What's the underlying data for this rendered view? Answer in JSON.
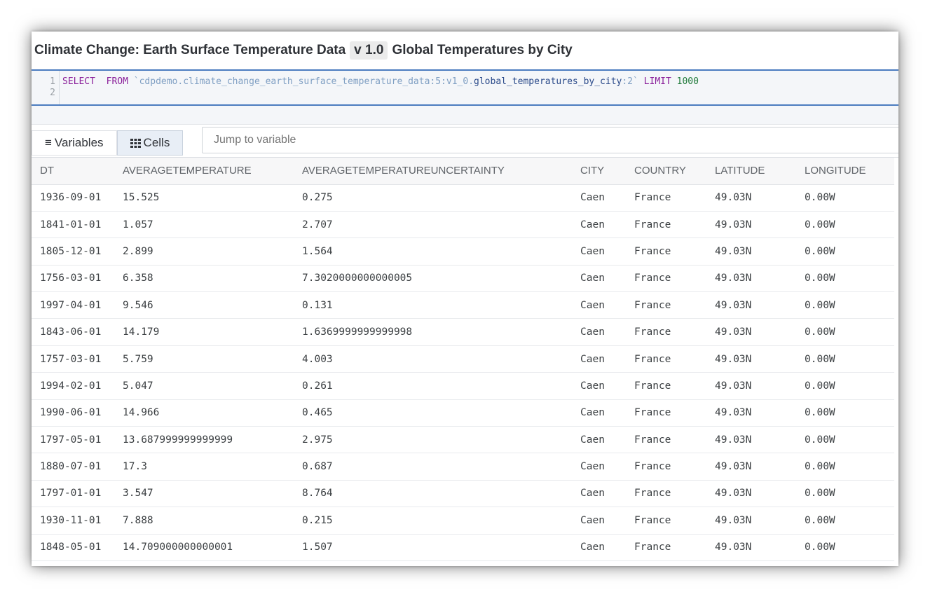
{
  "title": {
    "dataset": "Climate Change: Earth Surface Temperature Data",
    "version": "v 1.0",
    "table": "Global Temperatures by City"
  },
  "editor": {
    "line_numbers": [
      "1",
      "2"
    ],
    "kw_select": "SELECT",
    "kw_from": "FROM",
    "path_part": "`cdpdemo.climate_change_earth_surface_temperature_data:5:v1_0.",
    "ident_part": "global_temperatures_by_city",
    "version_part": ":2`",
    "kw_limit": "LIMIT",
    "limit_value": "1000"
  },
  "tabs": {
    "variables_label": "Variables",
    "cells_label": "Cells"
  },
  "search": {
    "placeholder": "Jump to variable"
  },
  "columns": [
    "DT",
    "AVERAGETEMPERATURE",
    "AVERAGETEMPERATUREUNCERTAINTY",
    "CITY",
    "COUNTRY",
    "LATITUDE",
    "LONGITUDE"
  ],
  "rows": [
    [
      "1936-09-01",
      "15.525",
      "0.275",
      "Caen",
      "France",
      "49.03N",
      "0.00W"
    ],
    [
      "1841-01-01",
      "1.057",
      "2.707",
      "Caen",
      "France",
      "49.03N",
      "0.00W"
    ],
    [
      "1805-12-01",
      "2.899",
      "1.564",
      "Caen",
      "France",
      "49.03N",
      "0.00W"
    ],
    [
      "1756-03-01",
      "6.358",
      "7.3020000000000005",
      "Caen",
      "France",
      "49.03N",
      "0.00W"
    ],
    [
      "1997-04-01",
      "9.546",
      "0.131",
      "Caen",
      "France",
      "49.03N",
      "0.00W"
    ],
    [
      "1843-06-01",
      "14.179",
      "1.6369999999999998",
      "Caen",
      "France",
      "49.03N",
      "0.00W"
    ],
    [
      "1757-03-01",
      "5.759",
      "4.003",
      "Caen",
      "France",
      "49.03N",
      "0.00W"
    ],
    [
      "1994-02-01",
      "5.047",
      "0.261",
      "Caen",
      "France",
      "49.03N",
      "0.00W"
    ],
    [
      "1990-06-01",
      "14.966",
      "0.465",
      "Caen",
      "France",
      "49.03N",
      "0.00W"
    ],
    [
      "1797-05-01",
      "13.687999999999999",
      "2.975",
      "Caen",
      "France",
      "49.03N",
      "0.00W"
    ],
    [
      "1880-07-01",
      "17.3",
      "0.687",
      "Caen",
      "France",
      "49.03N",
      "0.00W"
    ],
    [
      "1797-01-01",
      "3.547",
      "8.764",
      "Caen",
      "France",
      "49.03N",
      "0.00W"
    ],
    [
      "1930-11-01",
      "7.888",
      "0.215",
      "Caen",
      "France",
      "49.03N",
      "0.00W"
    ],
    [
      "1848-05-01",
      "14.709000000000001",
      "1.507",
      "Caen",
      "France",
      "49.03N",
      "0.00W"
    ]
  ]
}
